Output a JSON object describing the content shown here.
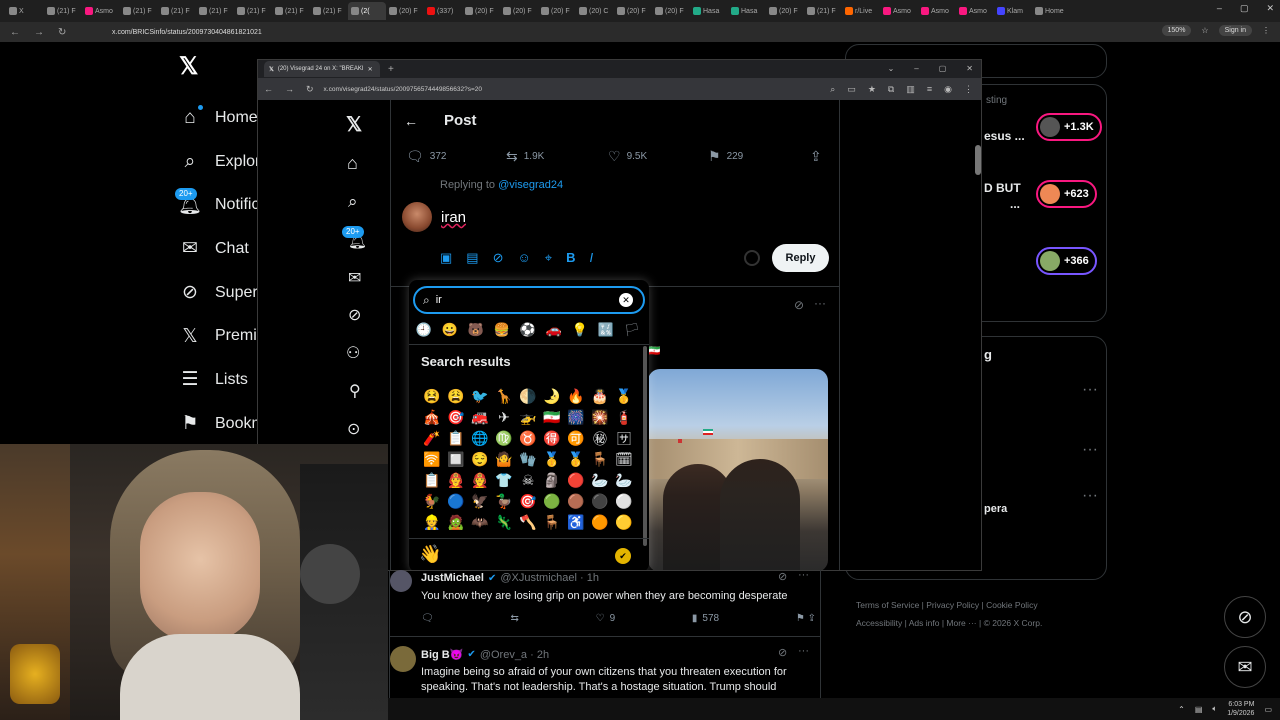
{
  "outer_browser": {
    "tabs": [
      {
        "label": "X",
        "color": "#888"
      },
      {
        "label": "(21) F",
        "color": "#888"
      },
      {
        "label": "Asmo",
        "color": "#f91880"
      },
      {
        "label": "(21) F",
        "color": "#888"
      },
      {
        "label": "(21) F",
        "color": "#888"
      },
      {
        "label": "(21) F",
        "color": "#888"
      },
      {
        "label": "(21) F",
        "color": "#888"
      },
      {
        "label": "(21) F",
        "color": "#888"
      },
      {
        "label": "(21) F",
        "color": "#888"
      },
      {
        "label": "(2(",
        "color": "#888"
      },
      {
        "label": "(20) F",
        "color": "#888"
      },
      {
        "label": "(337)",
        "color": "#e11"
      },
      {
        "label": "(20) F",
        "color": "#888"
      },
      {
        "label": "(20) F",
        "color": "#888"
      },
      {
        "label": "(20) F",
        "color": "#888"
      },
      {
        "label": "(20) C",
        "color": "#888"
      },
      {
        "label": "(20) F",
        "color": "#888"
      },
      {
        "label": "(20) F",
        "color": "#888"
      },
      {
        "label": "Hasa",
        "color": "#2a8"
      },
      {
        "label": "Hasa",
        "color": "#2a8"
      },
      {
        "label": "(20) F",
        "color": "#888"
      },
      {
        "label": "(21) F",
        "color": "#888"
      },
      {
        "label": "r/Live",
        "color": "#f60"
      },
      {
        "label": "Asmo",
        "color": "#f91880"
      },
      {
        "label": "Asmo",
        "color": "#f91880"
      },
      {
        "label": "Asmo",
        "color": "#f91880"
      },
      {
        "label": "Klam",
        "color": "#44f"
      },
      {
        "label": "Home",
        "color": "#888"
      }
    ],
    "active_tab_index": 9,
    "url": "x.com/BRICSinfo/status/2009730404861821021",
    "zoom": "150%",
    "signin": "Sign in"
  },
  "left_nav": [
    {
      "label": "Home",
      "icon": "home-icon",
      "glyph": "⌂"
    },
    {
      "label": "Explore",
      "icon": "search-icon",
      "glyph": "⌕"
    },
    {
      "label": "Notifications",
      "icon": "bell-icon",
      "glyph": "🔔︎",
      "badge": "20+"
    },
    {
      "label": "Chat",
      "icon": "mail-icon",
      "glyph": "✉"
    },
    {
      "label": "Super",
      "icon": "grok-icon",
      "glyph": "⊘"
    },
    {
      "label": "Premium",
      "icon": "x-premium-icon",
      "glyph": "𝕏"
    },
    {
      "label": "Lists",
      "icon": "list-icon",
      "glyph": "☰"
    },
    {
      "label": "Bookmarks",
      "icon": "bookmark-icon",
      "glyph": "⚑"
    }
  ],
  "right_panel": {
    "trend_1": "esus ...",
    "trend_2": "D BUT",
    "trend_3": "...",
    "trending_label": "sting",
    "counts": [
      "+1.3K",
      "+623",
      "+366"
    ],
    "section_letter": "g",
    "row_text": "pera",
    "footer": [
      "Terms of Service",
      "Privacy Policy",
      "Cookie Policy",
      "Accessibility",
      "Ads info",
      "More ···",
      "© 2026 X Corp."
    ]
  },
  "inner_browser": {
    "tab_title": "(20) Visegrad 24 on X: \"BREAKI",
    "url": "x.com/visegrad24/status/2009756574449856632?s=20",
    "post_header": "Post",
    "stats": {
      "replies": "372",
      "reposts": "1.9K",
      "likes": "9.5K",
      "bookmarks": "229"
    },
    "replying_to_prefix": "Replying to ",
    "replying_to_handle": "@visegrad24",
    "compose_text": "iran",
    "reply_button": "Reply",
    "nav_badge": "20+"
  },
  "emoji_picker": {
    "search_value": "ir",
    "search_results_label": "Search results",
    "categories": [
      "🕘",
      "😀",
      "🐻",
      "🍔",
      "⚽",
      "🚗",
      "💡",
      "🔣",
      "🏳"
    ],
    "emojis": [
      "😫",
      "😩",
      "🐦",
      "🦒",
      "🌗",
      "🌛",
      "🔥",
      "🎂",
      "🥇",
      "🎪",
      "🎯",
      "🚒",
      "✈",
      "🚁",
      "🇮🇷",
      "🎆",
      "🎇",
      "🧯",
      "🧨",
      "📋",
      "🌐",
      "♍",
      "♉",
      "🉐",
      "🉑",
      "㊙",
      "🈂",
      "🛜",
      "🔲",
      "😌",
      "🤷",
      "🧤",
      "🥇",
      "🥇",
      "🪑",
      "🗓",
      "📋",
      "👨‍🚒",
      "🧑‍🚒",
      "👕",
      "☠",
      "🗿",
      "🔴",
      "🦢",
      "🦢",
      "🐓",
      "🔵",
      "🦅",
      "🦆",
      "🎯",
      "🟢",
      "🟤",
      "⚫",
      "⚪",
      "👷",
      "🧟",
      "🦇",
      "🦎",
      "🪓",
      "🪑",
      "♿",
      "🟠",
      "🟡"
    ],
    "skin_tone_emoji": "👋",
    "check_emoji": "✔"
  },
  "replies": [
    {
      "name": "JustMichael",
      "handle": "@XJustmichael · 1h",
      "text": "You know they are losing grip on power when they are becoming desperate",
      "likes": "9",
      "views": "578"
    },
    {
      "name": "Big B😈",
      "handle": "@Orev_a · 2h",
      "text": "Imagine being so afraid of your own citizens that you threaten execution for speaking. That's not leadership. That's a hostage situation. Trump should"
    }
  ],
  "taskbar": {
    "time": "6:03 PM",
    "date": "1/9/2026"
  }
}
